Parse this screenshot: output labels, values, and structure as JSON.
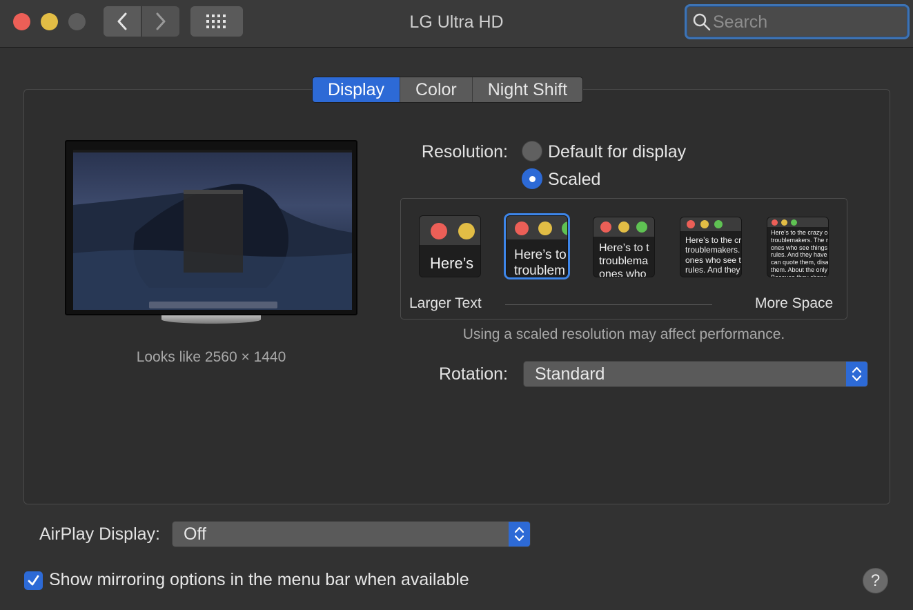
{
  "window": {
    "title": "LG Ultra HD",
    "search_placeholder": "Search"
  },
  "toolbar": {
    "back_icon": "chevron-left-icon",
    "forward_icon": "chevron-right-icon",
    "grid_icon": "grid-icon"
  },
  "tabs": [
    {
      "label": "Display",
      "active": true
    },
    {
      "label": "Color",
      "active": false
    },
    {
      "label": "Night Shift",
      "active": false
    }
  ],
  "display": {
    "looks_like": "Looks like 2560 × 1440",
    "resolution_label": "Resolution:",
    "options": [
      {
        "label": "Default for display",
        "selected": false
      },
      {
        "label": "Scaled",
        "selected": true
      }
    ],
    "scale_thumbs": [
      {
        "text": "Here’s",
        "selected": false
      },
      {
        "text": "Here’s to\ntroublem",
        "selected": true
      },
      {
        "text": "Here’s to t\ntroublema\nones who",
        "selected": false
      },
      {
        "text": "Here’s to the cr\ntroublemakers.\nones who see t\nrules. And they",
        "selected": false
      },
      {
        "text": "Here’s to the crazy one\ntroublemakers. The rou\nones who see things dif\nrules. And they have no\ncan quote them, disagre\nthem. About the only th\nBecause they change th",
        "selected": false
      }
    ],
    "larger_text": "Larger Text",
    "more_space": "More Space",
    "note": "Using a scaled resolution may affect performance.",
    "rotation_label": "Rotation:",
    "rotation_value": "Standard"
  },
  "airplay": {
    "label": "AirPlay Display:",
    "value": "Off"
  },
  "mirroring": {
    "label": "Show mirroring options in the menu bar when available",
    "checked": true
  },
  "help": "?",
  "colors": {
    "accent": "#2d6ad6",
    "red_light": "#ec5f57",
    "yellow_light": "#e2bd45",
    "green_light": "#5fc253"
  }
}
